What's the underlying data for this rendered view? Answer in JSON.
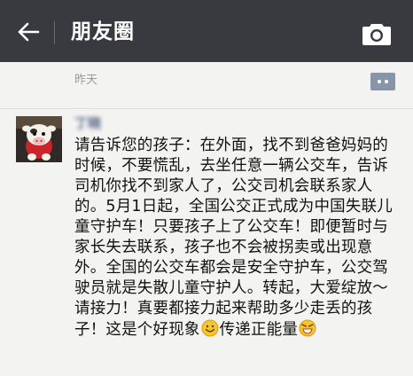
{
  "header": {
    "back_icon": "back-arrow-icon",
    "title": "朋友圈",
    "camera_icon": "camera-icon"
  },
  "previous_post": {
    "timestamp": "昨天",
    "comment_icon": "comment-bubble-icon"
  },
  "post": {
    "author_name": "丁晓",
    "avatar_icon": "cartoon-cow-avatar",
    "text": "请告诉您的孩子：在外面，找不到爸爸妈妈的时候，不要慌乱，去坐任意一辆公交车，告诉司机你找不到家人了，公交司机会联系家人的。5月1日起，全国公交正式成为中国失联儿童守护车！只要孩子上了公交车！即便暂时与家长失去联系，孩子也不会被拐卖或出现意外。全国的公交车都会是安全守护车，公交驾驶员就是失散儿童守护人。转起，大爱绽放～请接力！真要都接力起来帮助多少走丢的孩子！这是个好现象",
    "emoji_1": "smile-emoji",
    "text_tail": "传递正能量",
    "emoji_2": "grin-emoji"
  },
  "colors": {
    "topbar_bg": "#393a3f",
    "page_bg": "#f3f3f1",
    "nickname": "#59688a",
    "timestamp": "#9b9b9b"
  }
}
